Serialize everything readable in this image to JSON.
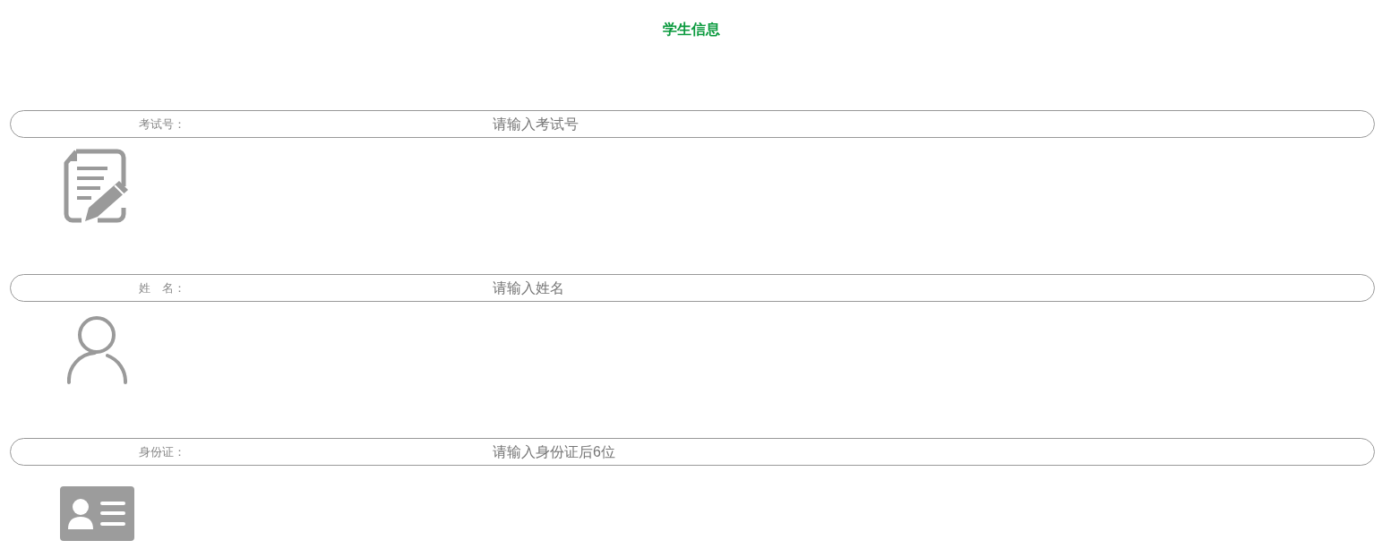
{
  "title": "学生信息",
  "fields": [
    {
      "label": "考试号：",
      "placeholder": "请输入考试号"
    },
    {
      "label": "姓　名：",
      "placeholder": "请输入姓名"
    },
    {
      "label": "身份证：",
      "placeholder": "请输入身份证后6位"
    }
  ]
}
